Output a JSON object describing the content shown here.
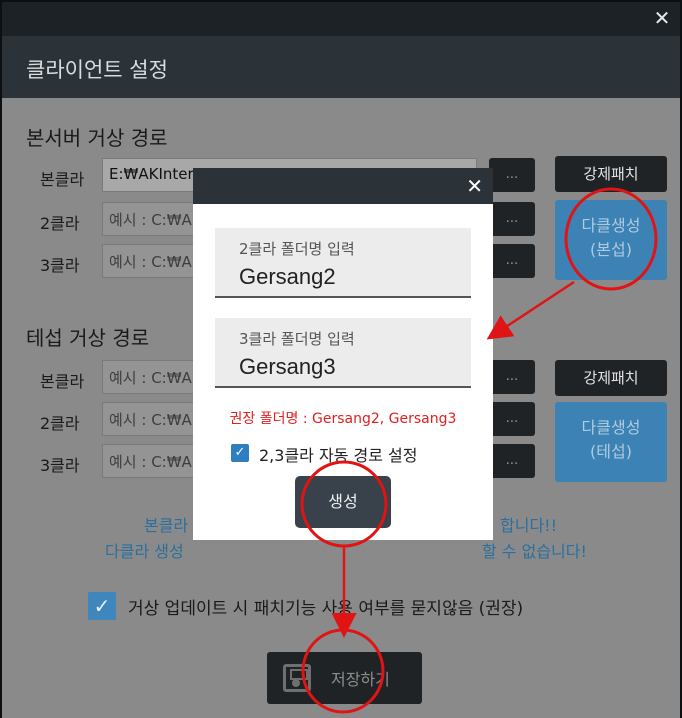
{
  "window": {
    "title": "클라이언트 설정",
    "close_glyph": "✕"
  },
  "main_server": {
    "title": "본서버 거상 경로",
    "rows": [
      {
        "label": "본클라",
        "value": "E:₩AKInterac...₩G...",
        "dots": "..."
      },
      {
        "label": "2클라",
        "placeholder": "예시 : C:₩A",
        "dots": "..."
      },
      {
        "label": "3클라",
        "placeholder": "예시 : C:₩A",
        "dots": "..."
      }
    ],
    "force_patch_label": "강제패치",
    "multi_create_line1": "다클생성",
    "multi_create_line2": "(본섭)"
  },
  "test_server": {
    "title": "테섭 거상 경로",
    "rows": [
      {
        "label": "본클라",
        "placeholder": "예시 : C:₩A",
        "dots": "..."
      },
      {
        "label": "2클라",
        "placeholder": "예시 : C:₩A",
        "dots": "..."
      },
      {
        "label": "3클라",
        "placeholder": "예시 : C:₩A",
        "dots": "..."
      }
    ],
    "force_patch_label": "강제패치",
    "multi_create_line1": "다클생성",
    "multi_create_line2": "(테섭)"
  },
  "notice": {
    "line1_left": "본클라",
    "line1_right": "합니다!!",
    "line2_left": "다클라 생성",
    "line2_right": "할 수 없습니다!"
  },
  "options": {
    "skip_patch_check_label": "거상 업데이트 시 패치기능 사용 여부를 묻지않음 (권장)",
    "skip_patch_checked": true
  },
  "save_button": {
    "label": "저장하기"
  },
  "modal": {
    "close_glyph": "✕",
    "field2": {
      "label": "2클라 폴더명 입력",
      "value": "Gersang2"
    },
    "field3": {
      "label": "3클라 폴더명 입력",
      "value": "Gersang3"
    },
    "recommend_text": "권장 폴더명 : Gersang2, Gersang3",
    "auto_path_label": "2,3클라 자동 경로 설정",
    "auto_path_checked": true,
    "create_button_label": "생성"
  },
  "colors": {
    "title_bar": "#2b3339",
    "accent_blue": "#3d82b4",
    "annotation_red": "#e01414",
    "warning_red": "#e02020"
  }
}
